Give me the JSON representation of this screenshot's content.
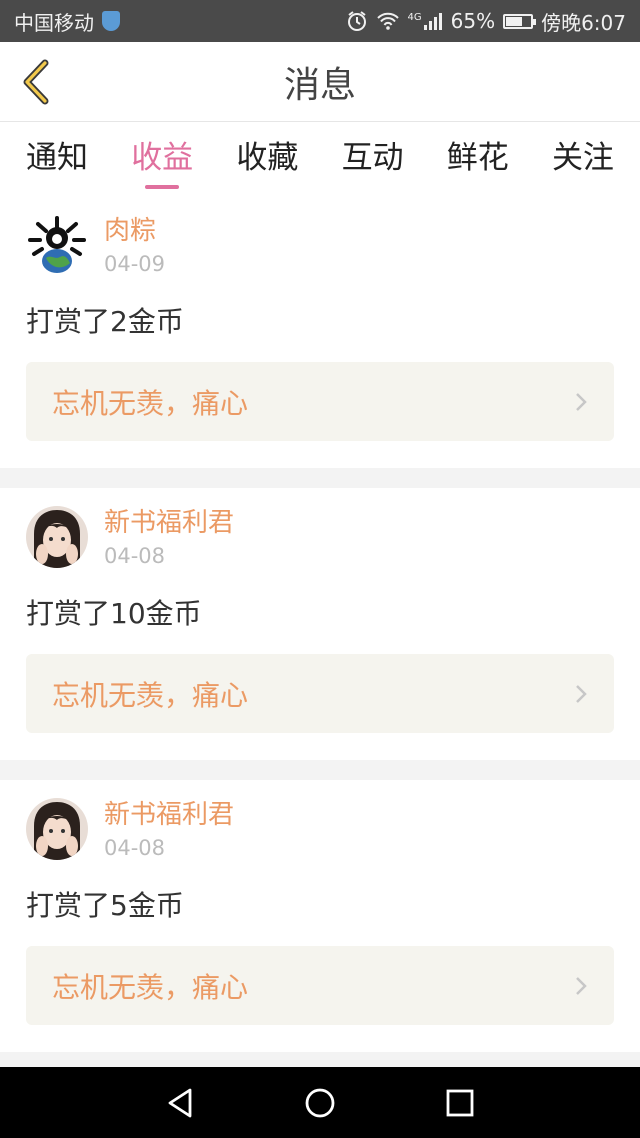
{
  "status_bar": {
    "carrier": "中国移动",
    "network": "4G",
    "battery": "65%",
    "battery_level": 0.65,
    "time": "傍晚6:07"
  },
  "header": {
    "title": "消息",
    "back_icon": "chevron-left-icon"
  },
  "tabs": [
    {
      "label": "通知",
      "active": false
    },
    {
      "label": "收益",
      "active": true
    },
    {
      "label": "收藏",
      "active": false
    },
    {
      "label": "互动",
      "active": false
    },
    {
      "label": "鲜花",
      "active": false
    },
    {
      "label": "关注",
      "active": false
    }
  ],
  "messages": [
    {
      "user": "肉粽",
      "date": "04-09",
      "reward": "打赏了2金币",
      "book": "忘机无羡，痛心"
    },
    {
      "user": "新书福利君",
      "date": "04-08",
      "reward": "打赏了10金币",
      "book": "忘机无羡，痛心"
    },
    {
      "user": "新书福利君",
      "date": "04-08",
      "reward": "打赏了5金币",
      "book": "忘机无羡，痛心"
    }
  ],
  "colors": {
    "accent": "#e0709e",
    "username": "#eb9a64",
    "date": "#bbbbbb",
    "ref_box_bg": "#f5f4ee",
    "status_bar_bg": "#4a4a4a"
  },
  "nav": [
    "back-triangle-icon",
    "home-circle-icon",
    "recents-square-icon"
  ]
}
